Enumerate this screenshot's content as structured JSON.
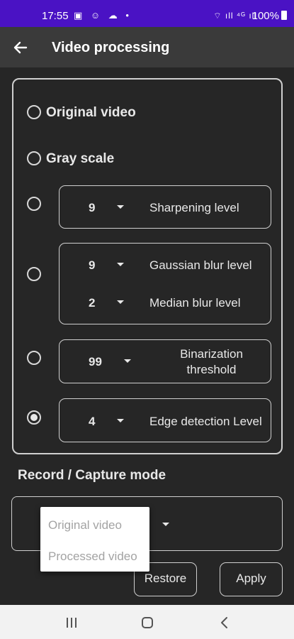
{
  "status_bar": {
    "time": "17:55",
    "left_icons": "▣ ☺ ☁ •",
    "right_icons": "⌔ ıll ⁴ᴳ ıll",
    "battery": "100%"
  },
  "app_bar": {
    "title": "Video processing"
  },
  "options": {
    "original": {
      "label": "Original video",
      "checked": false
    },
    "grayscale": {
      "label": "Gray scale",
      "checked": false
    },
    "sharpen": {
      "value": "9",
      "label": "Sharpening level",
      "checked": false
    },
    "blur": {
      "gaussian_value": "9",
      "gaussian_label": "Gaussian blur level",
      "median_value": "2",
      "median_label": "Median blur level",
      "checked": false
    },
    "binarize": {
      "value": "99",
      "label_line1": "Binarization",
      "label_line2": "threshold",
      "checked": false
    },
    "edge": {
      "value": "4",
      "label": "Edge detection Level",
      "checked": true
    }
  },
  "record_section": {
    "title": "Record / Capture mode"
  },
  "popup_menu": {
    "items": [
      "Original video",
      "Processed video"
    ]
  },
  "buttons": {
    "restore": "Restore",
    "apply": "Apply"
  },
  "colors": {
    "status_bar": "#4a12c4",
    "app_bar": "#3a3a3a",
    "background": "#262626"
  }
}
